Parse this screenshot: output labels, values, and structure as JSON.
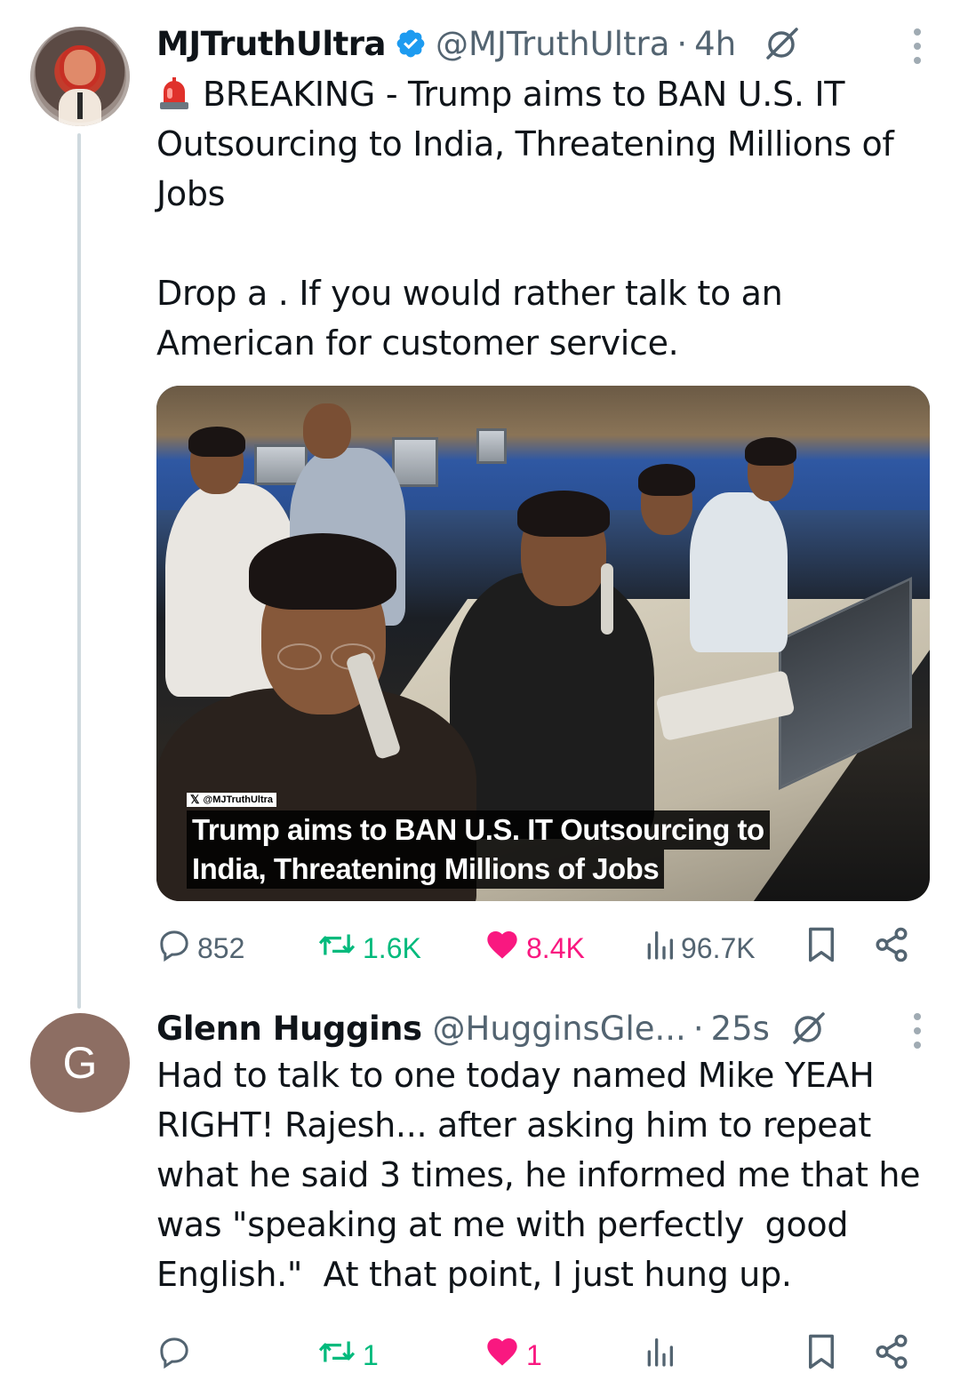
{
  "tweets": [
    {
      "name": "MJTruthUltra",
      "handle": "@MJTruthUltra",
      "separator": "·",
      "time": "4h",
      "text": "BREAKING - Trump aims to BAN U.S. IT Outsourcing to India, Threatening Millions of Jobs\n\nDrop a . If you would rather talk to an American for customer service.",
      "media": {
        "watermark": "@MJTruthUltra",
        "caption_line1": "Trump aims to BAN U.S. IT Outsourcing to",
        "caption_line2": "India, Threatening Millions of Jobs"
      },
      "stats": {
        "replies": "852",
        "retweets": "1.6K",
        "likes": "8.4K",
        "views": "96.7K"
      }
    },
    {
      "avatar_letter": "G",
      "name": "Glenn Huggins",
      "handle": "@HugginsGle...",
      "separator": "·",
      "time": "25s",
      "text": "Had to talk to one today named Mike YEAH RIGHT! Rajesh... after asking him to repeat what he said 3 times, he informed me that he was \"speaking at me with perfectly  good English.\"  At that point, I just hung up.",
      "stats": {
        "retweets": "1",
        "likes": "1"
      }
    }
  ],
  "colors": {
    "verified": "#1d9bf0",
    "retweet": "#00ba7c",
    "like": "#f91880",
    "muted": "#536471",
    "thread_line": "#cfd9de",
    "avatar_g": "#8d6e63"
  },
  "icons": [
    "reply-icon",
    "retweet-icon",
    "like-icon",
    "views-icon",
    "bookmark-icon",
    "share-icon",
    "grok-icon",
    "more-icon",
    "verified-badge-icon",
    "siren-emoji-icon"
  ]
}
